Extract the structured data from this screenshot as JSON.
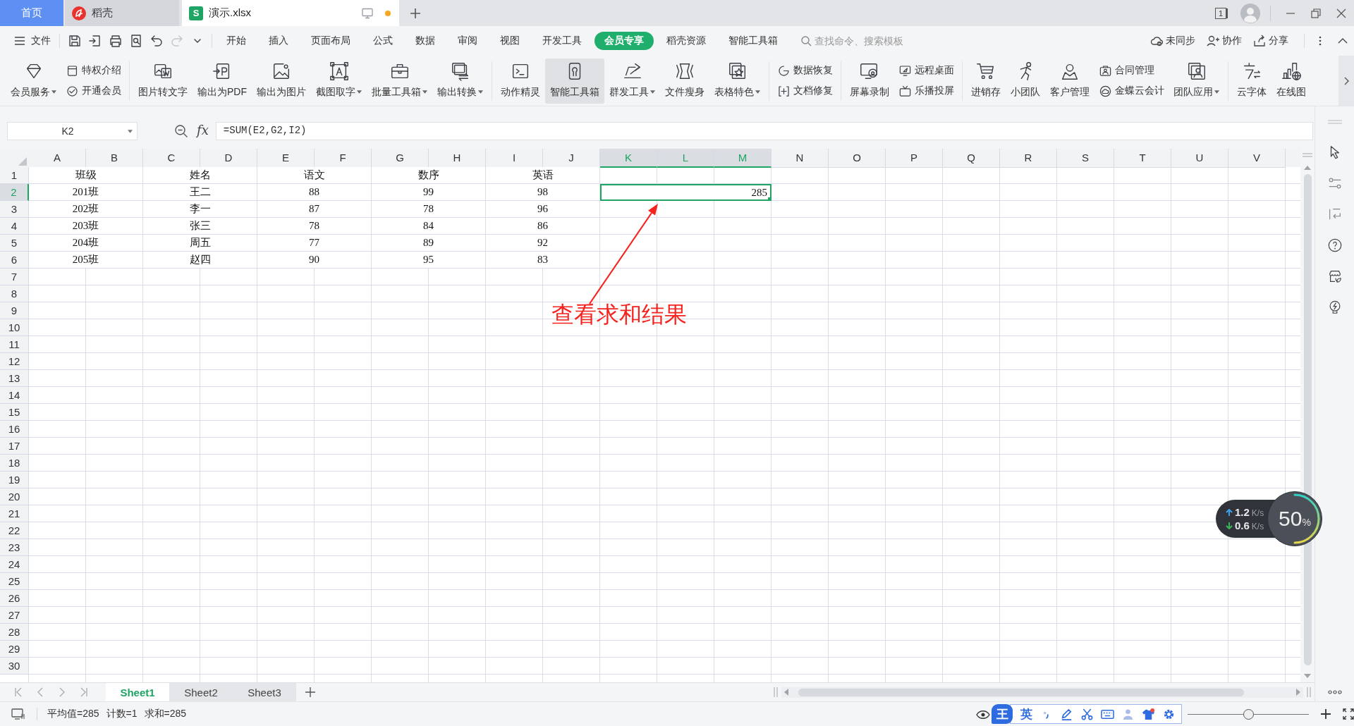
{
  "tabs": [
    {
      "label": "首页",
      "kind": "home",
      "selected": false
    },
    {
      "label": "稻壳",
      "kind": "app",
      "selected": false
    },
    {
      "label": "演示.xlsx",
      "kind": "document",
      "badge": "S",
      "selected": true,
      "modified": true
    }
  ],
  "window_count": "1",
  "menu": {
    "file": "文件",
    "quick_access": [
      {
        "disabled": false
      },
      {
        "disabled": false
      },
      {
        "disabled": false
      },
      {
        "disabled": false
      },
      {
        "disabled": false
      },
      {
        "disabled": true
      },
      {
        "disabled": false
      }
    ],
    "tabs": [
      {
        "label": "开始",
        "selected": false
      },
      {
        "label": "插入",
        "selected": false
      },
      {
        "label": "页面布局",
        "selected": false
      },
      {
        "label": "公式",
        "selected": false
      },
      {
        "label": "数据",
        "selected": false
      },
      {
        "label": "审阅",
        "selected": false
      },
      {
        "label": "视图",
        "selected": false
      },
      {
        "label": "开发工具",
        "selected": false
      },
      {
        "label": "会员专享",
        "selected": true
      },
      {
        "label": "稻壳资源",
        "selected": false
      },
      {
        "label": "智能工具箱",
        "selected": false
      }
    ],
    "search": {
      "placeholder": "查找命令、搜索模板"
    },
    "actions": [
      "未同步",
      "协作",
      "分享"
    ]
  },
  "ribbon": {
    "groups": [
      {
        "items": [
          {
            "kind": "large",
            "label": "会员服务",
            "dropdown": true,
            "highlighted": false
          },
          {
            "kind": "stack",
            "items": [
              {
                "label": "特权介绍"
              },
              {
                "label": "开通会员"
              }
            ]
          }
        ]
      },
      {
        "items": [
          {
            "kind": "large",
            "label": "图片转文字",
            "dropdown": false,
            "highlighted": false
          },
          {
            "kind": "large",
            "label": "输出为PDF",
            "dropdown": false,
            "highlighted": false
          },
          {
            "kind": "large",
            "label": "输出为图片",
            "dropdown": false,
            "highlighted": false
          },
          {
            "kind": "large",
            "label": "截图取字",
            "dropdown": true,
            "highlighted": false
          },
          {
            "kind": "large",
            "label": "批量工具箱",
            "dropdown": true,
            "highlighted": false
          },
          {
            "kind": "large",
            "label": "输出转换",
            "dropdown": true,
            "highlighted": false
          }
        ]
      },
      {
        "items": [
          {
            "kind": "large",
            "label": "动作精灵",
            "dropdown": false,
            "highlighted": false
          },
          {
            "kind": "large",
            "label": "智能工具箱",
            "dropdown": false,
            "highlighted": true
          },
          {
            "kind": "large",
            "label": "群发工具",
            "dropdown": true,
            "highlighted": false
          },
          {
            "kind": "large",
            "label": "文件瘦身",
            "dropdown": false,
            "highlighted": false
          },
          {
            "kind": "large",
            "label": "表格特色",
            "dropdown": true,
            "highlighted": false
          }
        ]
      },
      {
        "items": [
          {
            "kind": "stack",
            "items": [
              {
                "label": "数据恢复"
              },
              {
                "label": "文档修复"
              }
            ]
          }
        ]
      },
      {
        "items": [
          {
            "kind": "large",
            "label": "屏幕录制",
            "dropdown": false,
            "highlighted": false
          },
          {
            "kind": "stack",
            "items": [
              {
                "label": "远程桌面"
              },
              {
                "label": "乐播投屏"
              }
            ]
          }
        ]
      },
      {
        "items": [
          {
            "kind": "large",
            "label": "进销存",
            "dropdown": false,
            "highlighted": false
          },
          {
            "kind": "large",
            "label": "小团队",
            "dropdown": false,
            "highlighted": false
          },
          {
            "kind": "large",
            "label": "客户管理",
            "dropdown": false,
            "highlighted": false
          },
          {
            "kind": "stack",
            "items": [
              {
                "label": "合同管理"
              },
              {
                "label": "金蝶云会计"
              }
            ]
          },
          {
            "kind": "large",
            "label": "团队应用",
            "dropdown": true,
            "highlighted": false
          }
        ]
      },
      {
        "items": [
          {
            "kind": "large",
            "label": "云字体",
            "dropdown": false,
            "highlighted": false
          },
          {
            "kind": "large",
            "label": "在线图",
            "dropdown": false,
            "highlighted": false
          }
        ]
      }
    ]
  },
  "formula_bar": {
    "name_box": "K2",
    "fx": "fx",
    "formula": "=SUM(E2,G2,I2)"
  },
  "grid": {
    "columns": [
      {
        "label": "A",
        "selected": false
      },
      {
        "label": "B",
        "selected": false
      },
      {
        "label": "C",
        "selected": false
      },
      {
        "label": "D",
        "selected": false
      },
      {
        "label": "E",
        "selected": false
      },
      {
        "label": "F",
        "selected": false
      },
      {
        "label": "G",
        "selected": false
      },
      {
        "label": "H",
        "selected": false
      },
      {
        "label": "I",
        "selected": false
      },
      {
        "label": "J",
        "selected": false
      },
      {
        "label": "K",
        "selected": true
      },
      {
        "label": "L",
        "selected": true
      },
      {
        "label": "M",
        "selected": true
      },
      {
        "label": "N",
        "selected": false
      },
      {
        "label": "O",
        "selected": false
      },
      {
        "label": "P",
        "selected": false
      },
      {
        "label": "Q",
        "selected": false
      },
      {
        "label": "R",
        "selected": false
      },
      {
        "label": "S",
        "selected": false
      },
      {
        "label": "T",
        "selected": false
      },
      {
        "label": "U",
        "selected": false
      },
      {
        "label": "V",
        "selected": false
      }
    ],
    "rows": [
      {
        "label": "1",
        "selected": false,
        "cells": [
          "班级",
          "姓名",
          "语文",
          "数序",
          "英语"
        ]
      },
      {
        "label": "2",
        "selected": true,
        "cells": [
          "201班",
          "王二",
          "88",
          "99",
          "98"
        ],
        "result": "285"
      },
      {
        "label": "3",
        "selected": false,
        "cells": [
          "202班",
          "李一",
          "87",
          "78",
          "96"
        ]
      },
      {
        "label": "4",
        "selected": false,
        "cells": [
          "203班",
          "张三",
          "78",
          "84",
          "86"
        ]
      },
      {
        "label": "5",
        "selected": false,
        "cells": [
          "204班",
          "周五",
          "77",
          "89",
          "92"
        ]
      },
      {
        "label": "6",
        "selected": false,
        "cells": [
          "205班",
          "赵四",
          "90",
          "95",
          "83"
        ]
      },
      {
        "label": "7",
        "selected": false
      },
      {
        "label": "8",
        "selected": false
      },
      {
        "label": "9",
        "selected": false
      },
      {
        "label": "10",
        "selected": false
      },
      {
        "label": "11",
        "selected": false
      },
      {
        "label": "12",
        "selected": false
      },
      {
        "label": "13",
        "selected": false
      },
      {
        "label": "14",
        "selected": false
      },
      {
        "label": "15",
        "selected": false
      },
      {
        "label": "16",
        "selected": false
      },
      {
        "label": "17",
        "selected": false
      },
      {
        "label": "18",
        "selected": false
      },
      {
        "label": "19",
        "selected": false
      },
      {
        "label": "20",
        "selected": false
      },
      {
        "label": "21",
        "selected": false
      },
      {
        "label": "22",
        "selected": false
      },
      {
        "label": "23",
        "selected": false
      },
      {
        "label": "24",
        "selected": false
      },
      {
        "label": "25",
        "selected": false
      },
      {
        "label": "26",
        "selected": false
      },
      {
        "label": "27",
        "selected": false
      },
      {
        "label": "28",
        "selected": false
      },
      {
        "label": "29",
        "selected": false
      },
      {
        "label": "30",
        "selected": false
      }
    ]
  },
  "annotation": {
    "text": "查看求和结果"
  },
  "sheets": [
    {
      "label": "Sheet1",
      "selected": true
    },
    {
      "label": "Sheet2",
      "selected": false
    },
    {
      "label": "Sheet3",
      "selected": false
    }
  ],
  "status_bar": {
    "stats": [
      "平均值=285",
      "计数=1",
      "求和=285"
    ],
    "ime": {
      "logo": "王",
      "mode": "英"
    },
    "zoom": {
      "level": 0.5
    }
  },
  "speed_widget": {
    "upload": {
      "value": "1.2",
      "unit": "K/s"
    },
    "download": {
      "value": "0.6",
      "unit": "K/s"
    },
    "load": {
      "value": "50",
      "unit": "%",
      "level": 0.5
    }
  }
}
